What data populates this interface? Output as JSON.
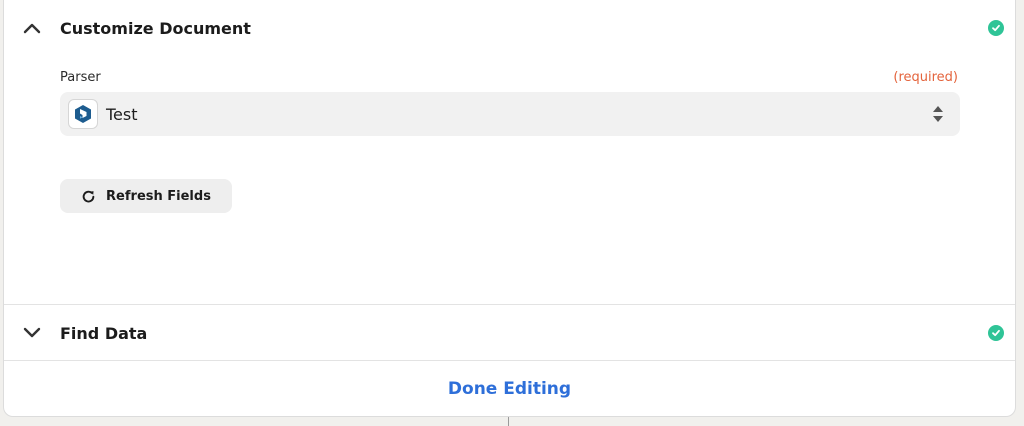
{
  "sections": {
    "customize": {
      "title": "Customize Document",
      "chevron_icon": "chevron-up-icon",
      "status_icon": "check-circle-icon"
    },
    "find": {
      "title": "Find Data",
      "chevron_icon": "chevron-down-icon",
      "status_icon": "check-circle-icon"
    }
  },
  "parser_field": {
    "label": "Parser",
    "required_text": "(required)",
    "selected_value": "Test",
    "app_icon": "docparser-logo-icon",
    "control_icon": "sort-updown-icon"
  },
  "refresh_button": {
    "label": "Refresh Fields",
    "icon": "refresh-icon"
  },
  "footer": {
    "done_label": "Done Editing"
  },
  "colors": {
    "accent": "#2e6fd9",
    "success": "#2fc497",
    "required": "#e4643d",
    "logo": "#1d5c8f"
  }
}
